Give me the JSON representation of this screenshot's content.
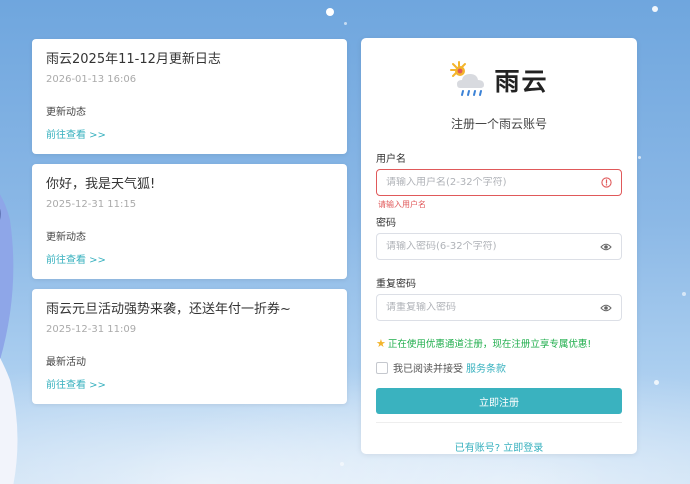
{
  "news": [
    {
      "title": "雨云2025年11-12月更新日志",
      "date": "2026-01-13 16:06",
      "category": "更新动态",
      "link": "前往查看 >>"
    },
    {
      "title": "你好，我是天气狐!",
      "date": "2025-12-31 11:15",
      "category": "更新动态",
      "link": "前往查看 >>"
    },
    {
      "title": "雨云元旦活动强势来袭，还送年付一折券~",
      "date": "2025-12-31 11:09",
      "category": "最新活动",
      "link": "前往查看 >>"
    }
  ],
  "register": {
    "logo_text": "雨云",
    "logo_icon": "weather-cloud-rain-icon",
    "subtitle": "注册一个雨云账号",
    "username_label": "用户名",
    "username_placeholder": "请输入用户名(2-32个字符)",
    "username_value": "",
    "username_error": "请输入用户名",
    "password_label": "密码",
    "password_placeholder": "请输入密码(6-32个字符)",
    "confirm_label": "重复密码",
    "confirm_placeholder": "请重复输入密码",
    "promo_text": "正在使用优惠通道注册，现在注册立享专属优惠!",
    "agree_text": "我已阅读并接受",
    "terms_link": "服务条款",
    "submit_label": "立即注册",
    "login_link": "已有账号? 立即登录"
  },
  "colors": {
    "accent": "#3ab2bf",
    "error": "#e0595a",
    "promo": "#1fae4c"
  }
}
